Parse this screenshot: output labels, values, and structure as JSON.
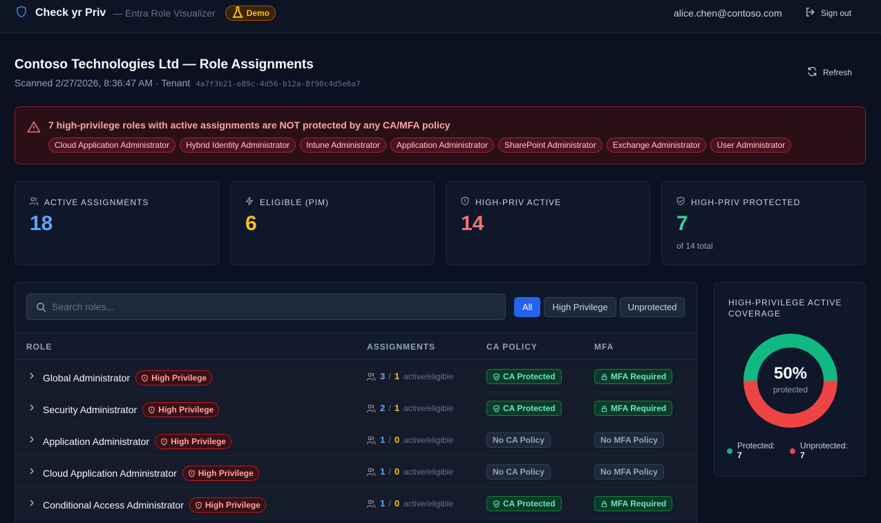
{
  "header": {
    "brand": "Check yr Priv",
    "subtitle": "— Entra Role Visualizer",
    "demo_badge": "Demo",
    "user_email": "alice.chen@contoso.com",
    "signout_label": "Sign out"
  },
  "page": {
    "title": "Contoso Technologies Ltd — Role Assignments",
    "scanned_text": "Scanned 2/27/2026, 8:36:47 AM · Tenant",
    "tenant_id": "4a7f3b21-e89c-4d56-b12a-8f90c4d5e6a7",
    "refresh_label": "Refresh"
  },
  "alert": {
    "message": "7 high-privilege roles with active assignments are NOT protected by any CA/MFA policy",
    "roles": [
      "Cloud Application Administrator",
      "Hybrid Identity Administrator",
      "Intune Administrator",
      "Application Administrator",
      "SharePoint Administrator",
      "Exchange Administrator",
      "User Administrator"
    ]
  },
  "stats": [
    {
      "label": "Active Assignments",
      "value": "18",
      "sub": "",
      "icon": "users-icon",
      "color": "#60a5fa"
    },
    {
      "label": "Eligible (PIM)",
      "value": "6",
      "sub": "",
      "icon": "bolt-icon",
      "color": "#fbbf24"
    },
    {
      "label": "High-Priv Active",
      "value": "14",
      "sub": "",
      "icon": "shield-alert-icon",
      "color": "#f87171"
    },
    {
      "label": "High-Priv Protected",
      "value": "7",
      "sub": "of 14 total",
      "icon": "shield-check-icon",
      "color": "#34d399"
    }
  ],
  "table": {
    "search_placeholder": "Search roles...",
    "filters": [
      "All",
      "High Privilege",
      "Unprotected"
    ],
    "active_filter": "All",
    "columns": [
      "ROLE",
      "ASSIGNMENTS",
      "CA POLICY",
      "MFA"
    ],
    "assign_label": "active/eligible",
    "high_priv_label": "High Privilege",
    "rows": [
      {
        "role": "Global Administrator",
        "active": "3",
        "eligible": "1",
        "ca": "CA Protected",
        "ca_ok": true,
        "mfa": "MFA Required",
        "mfa_ok": true
      },
      {
        "role": "Security Administrator",
        "active": "2",
        "eligible": "1",
        "ca": "CA Protected",
        "ca_ok": true,
        "mfa": "MFA Required",
        "mfa_ok": true
      },
      {
        "role": "Application Administrator",
        "active": "1",
        "eligible": "0",
        "ca": "No CA Policy",
        "ca_ok": false,
        "mfa": "No MFA Policy",
        "mfa_ok": false
      },
      {
        "role": "Cloud Application Administrator",
        "active": "1",
        "eligible": "0",
        "ca": "No CA Policy",
        "ca_ok": false,
        "mfa": "No MFA Policy",
        "mfa_ok": false
      },
      {
        "role": "Conditional Access Administrator",
        "active": "1",
        "eligible": "0",
        "ca": "CA Protected",
        "ca_ok": true,
        "mfa": "MFA Required",
        "mfa_ok": true
      }
    ]
  },
  "coverage": {
    "title": "High-Privilege Active Coverage",
    "percent_text": "50%",
    "percent_label": "protected",
    "protected_fraction": 0.5,
    "protected_label": "Protected:",
    "protected_count": "7",
    "unprotected_label": "Unprotected:",
    "unprotected_count": "7",
    "protected_color": "#10b981",
    "unprotected_color": "#ef4444"
  }
}
